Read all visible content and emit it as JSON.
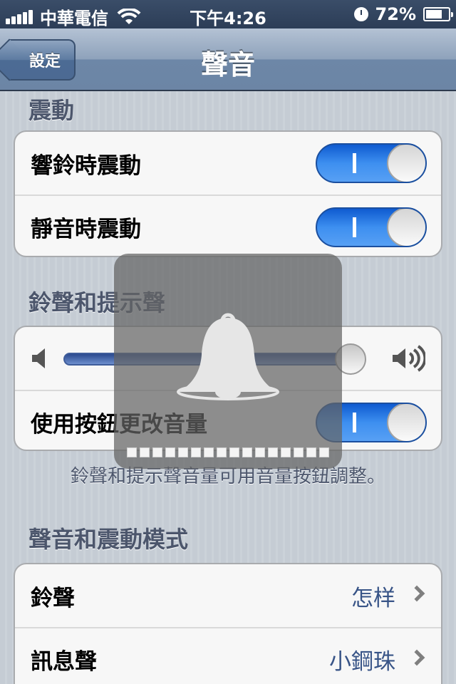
{
  "status_bar": {
    "carrier": "中華電信",
    "time": "下午4:26",
    "battery_percent_text": "72%",
    "battery_level": 0.72
  },
  "nav": {
    "back_label": "設定",
    "title": "聲音"
  },
  "vibration": {
    "header": "震動",
    "rows": [
      {
        "label": "響鈴時震動",
        "on": true
      },
      {
        "label": "靜音時震動",
        "on": true
      }
    ]
  },
  "ringer": {
    "header": "鈴聲和提示聲",
    "volume_level": 0.96,
    "change_with_buttons_label": "使用按鈕更改音量",
    "change_with_buttons_on": true,
    "footnote": "鈴聲和提示聲音量可用音量按鈕調整。"
  },
  "patterns": {
    "header": "聲音和震動模式",
    "rows": [
      {
        "label": "鈴聲",
        "value": "怎样"
      },
      {
        "label": "訊息聲",
        "value": "小鋼珠"
      }
    ]
  },
  "hud": {
    "icon": "bell-icon",
    "level_segments": 16,
    "level_filled": 16
  },
  "colors": {
    "switch_on": "#2a7ae6",
    "value_text": "#385487",
    "section_header": "#4c566c"
  }
}
